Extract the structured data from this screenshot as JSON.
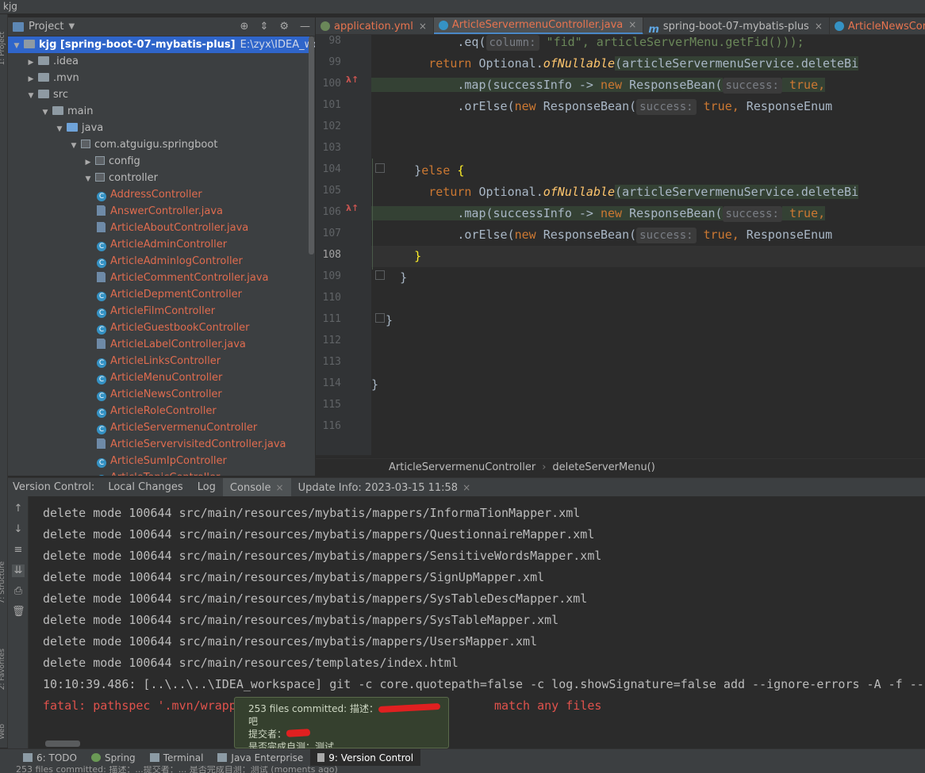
{
  "window": {
    "title": "kjg"
  },
  "left_stripe": {
    "project_label": "1: Project",
    "structure_label": "7: Structure",
    "favorites_label": "2: Favorites",
    "web_label": "Web"
  },
  "project_panel": {
    "title": "Project",
    "tree": [
      {
        "label": "kjg [spring-boot-07-mybatis-plus]",
        "hint": "E:\\zyx\\IDEA_workspace",
        "depth": 0,
        "arrow": "▼",
        "icon": "folder",
        "selected": true
      },
      {
        "label": ".idea",
        "depth": 1,
        "arrow": "▶",
        "icon": "folder"
      },
      {
        "label": ".mvn",
        "depth": 1,
        "arrow": "▶",
        "icon": "folder"
      },
      {
        "label": "src",
        "depth": 1,
        "arrow": "▼",
        "icon": "folder"
      },
      {
        "label": "main",
        "depth": 2,
        "arrow": "▼",
        "icon": "folder"
      },
      {
        "label": "java",
        "depth": 3,
        "arrow": "▼",
        "icon": "folder-blue"
      },
      {
        "label": "com.atguigu.springboot",
        "depth": 4,
        "arrow": "▼",
        "icon": "package"
      },
      {
        "label": "config",
        "depth": 5,
        "arrow": "▶",
        "icon": "package"
      },
      {
        "label": "controller",
        "depth": 5,
        "arrow": "▼",
        "icon": "package"
      },
      {
        "label": "AddressController",
        "depth": 6,
        "icon": "class",
        "red": true
      },
      {
        "label": "AnswerController.java",
        "depth": 6,
        "icon": "java-file",
        "red": true
      },
      {
        "label": "ArticleAboutController.java",
        "depth": 6,
        "icon": "java-file",
        "red": true
      },
      {
        "label": "ArticleAdminController",
        "depth": 6,
        "icon": "class",
        "red": true
      },
      {
        "label": "ArticleAdminlogController",
        "depth": 6,
        "icon": "class",
        "red": true
      },
      {
        "label": "ArticleCommentController.java",
        "depth": 6,
        "icon": "java-file",
        "red": true
      },
      {
        "label": "ArticleDepmentController",
        "depth": 6,
        "icon": "class",
        "red": true
      },
      {
        "label": "ArticleFilmController",
        "depth": 6,
        "icon": "class",
        "red": true
      },
      {
        "label": "ArticleGuestbookController",
        "depth": 6,
        "icon": "class",
        "red": true
      },
      {
        "label": "ArticleLabelController.java",
        "depth": 6,
        "icon": "java-file",
        "red": true
      },
      {
        "label": "ArticleLinksController",
        "depth": 6,
        "icon": "class",
        "red": true
      },
      {
        "label": "ArticleMenuController",
        "depth": 6,
        "icon": "class",
        "red": true
      },
      {
        "label": "ArticleNewsController",
        "depth": 6,
        "icon": "class",
        "red": true
      },
      {
        "label": "ArticleRoleController",
        "depth": 6,
        "icon": "class",
        "red": true
      },
      {
        "label": "ArticleServermenuController",
        "depth": 6,
        "icon": "class",
        "red": true
      },
      {
        "label": "ArticleServervisitedController.java",
        "depth": 6,
        "icon": "java-file",
        "red": true
      },
      {
        "label": "ArticleSumIpController",
        "depth": 6,
        "icon": "class",
        "red": true
      },
      {
        "label": "ArticleTopicController",
        "depth": 6,
        "icon": "class",
        "red": true
      }
    ]
  },
  "editor": {
    "tabs": [
      {
        "label": "application.yml",
        "icon": "yml"
      },
      {
        "label": "ArticleServermenuController.java",
        "icon": "class",
        "active": true
      },
      {
        "label": "spring-boot-07-mybatis-plus",
        "icon": "m"
      },
      {
        "label": "ArticleNewsController.java",
        "icon": "class"
      }
    ],
    "line_numbers": [
      "98",
      "99",
      "100",
      "101",
      "102",
      "103",
      "104",
      "105",
      "106",
      "107",
      "108",
      "109",
      "110",
      "111",
      "112",
      "113",
      "114",
      "115",
      "116"
    ],
    "current_line": "108",
    "code": {
      "l98_a": "            .eq(",
      "l98_hint": "column:",
      "l98_b": " \"fid\", articleServerMenu.getFid()));",
      "l99_kw": "        return ",
      "l99_a": "Optional.",
      "l99_it": "ofNullable",
      "l99_b": "(articleServermenuService.deleteBi",
      "l100_a": "            .map(successInfo -> ",
      "l100_kw": "new ",
      "l100_b": "ResponseBean(",
      "l100_hint": "success:",
      "l100_c": " true,",
      "l101_a": "            .orElse(",
      "l101_kw": "new ",
      "l101_b": "ResponseBean(",
      "l101_hint": "success:",
      "l101_c": " true,",
      "l101_d": " ResponseEnum",
      "l104_a": "      }",
      "l104_kw": "else",
      "l104_b": " {",
      "l105_kw": "        return ",
      "l105_a": "Optional.",
      "l105_it": "ofNullable",
      "l105_b": "(articleServermenuService.deleteBi",
      "l106_a": "            .map(successInfo -> ",
      "l106_kw": "new ",
      "l106_b": "ResponseBean(",
      "l106_hint": "success:",
      "l106_c": " true,",
      "l107_a": "            .orElse(",
      "l107_kw": "new ",
      "l107_b": "ResponseBean(",
      "l107_hint": "success:",
      "l107_c": " true,",
      "l107_d": " ResponseEnum",
      "l108": "      }",
      "l109": "    }",
      "l111": "  }",
      "l114": "}"
    }
  },
  "breadcrumb": {
    "class_name": "ArticleServermenuController",
    "method": "deleteServerMenu()",
    "sep": "›"
  },
  "version_control": {
    "title": "Version Control:",
    "tabs": [
      {
        "label": "Local Changes"
      },
      {
        "label": "Log"
      },
      {
        "label": "Console",
        "active": true,
        "closable": true
      },
      {
        "label": "Update Info: 2023-03-15 11:58",
        "closable": true
      }
    ],
    "console_lines": [
      "delete mode 100644 src/main/resources/mybatis/mappers/InformaTionMapper.xml",
      "delete mode 100644 src/main/resources/mybatis/mappers/QuestionnaireMapper.xml",
      "delete mode 100644 src/main/resources/mybatis/mappers/SensitiveWordsMapper.xml",
      "delete mode 100644 src/main/resources/mybatis/mappers/SignUpMapper.xml",
      "delete mode 100644 src/main/resources/mybatis/mappers/SysTableDescMapper.xml",
      "delete mode 100644 src/main/resources/mybatis/mappers/SysTableMapper.xml",
      "delete mode 100644 src/main/resources/mybatis/mappers/UsersMapper.xml",
      "delete mode 100644 src/main/resources/templates/index.html"
    ],
    "command_line": "10:10:39.486: [..\\..\\..\\IDEA_workspace] git -c core.quotepath=false -c log.showSignature=false add --ignore-errors -A -f --",
    "error_line": "fatal: pathspec '.mvn/wrapp                                    match any files"
  },
  "notification": {
    "line1": "253 files committed: 描述：",
    "line1_tail": "吧",
    "line2": "提交者：",
    "line3": "是否完成自测：测试"
  },
  "bottom_bar": {
    "buttons": [
      {
        "label": "6: TODO"
      },
      {
        "label": "Spring"
      },
      {
        "label": "Terminal"
      },
      {
        "label": "Java Enterprise"
      },
      {
        "label": "9: Version Control",
        "active": true
      }
    ]
  },
  "status_bar": {
    "text": "253 files committed: 描述：...提交者：... 是否完成自测：测试 (moments ago)"
  },
  "colors": {
    "accent": "#2f65ca",
    "error": "#e0524c",
    "modified_file": "#e06c4f",
    "keyword": "#cc7832"
  }
}
